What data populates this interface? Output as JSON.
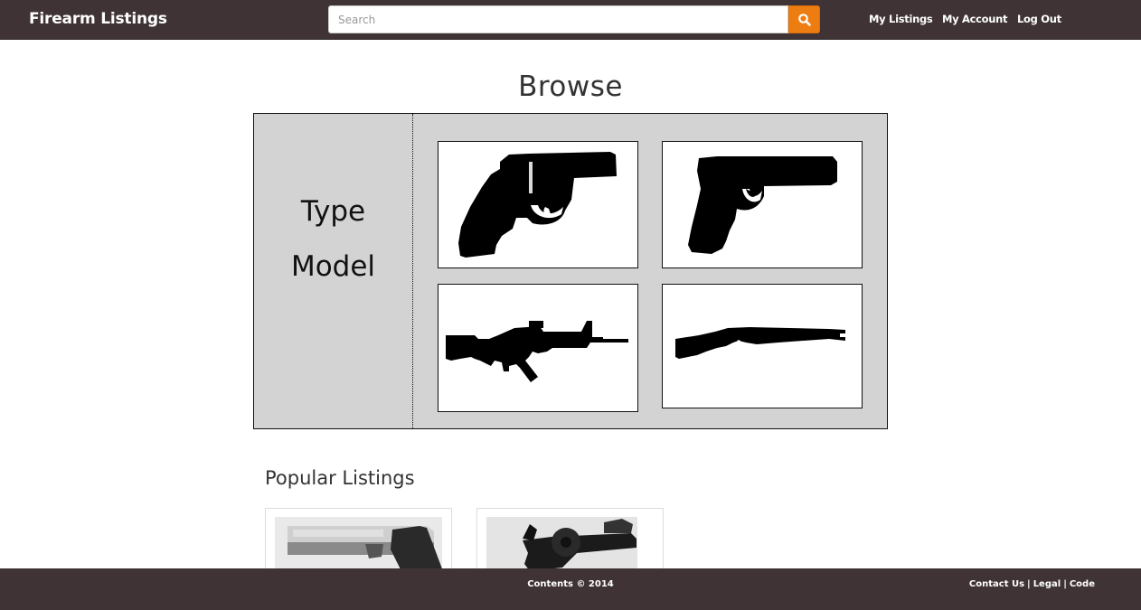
{
  "header": {
    "brand": "Firearm Listings",
    "search": {
      "placeholder": "Search",
      "value": "",
      "button_icon": "search-icon"
    },
    "nav": [
      {
        "label": "My Listings"
      },
      {
        "label": "My Account"
      },
      {
        "label": "Log Out"
      }
    ]
  },
  "browse": {
    "title": "Browse",
    "filters": [
      {
        "label": "Type"
      },
      {
        "label": "Model"
      }
    ],
    "tiles": [
      {
        "icon": "revolver-icon"
      },
      {
        "icon": "pistol-icon"
      },
      {
        "icon": "rifle-icon"
      },
      {
        "icon": "shotgun-icon"
      }
    ]
  },
  "popular": {
    "title": "Popular Listings",
    "items": [
      {
        "image": "silver-pistol-photo"
      },
      {
        "image": "black-revolver-photo"
      }
    ]
  },
  "footer": {
    "copyright": "Contents © 2014",
    "links": [
      {
        "label": "Contact Us"
      },
      {
        "label": "Legal"
      },
      {
        "label": "Code"
      }
    ],
    "separator": "|"
  },
  "colors": {
    "navbar": "#3f3335",
    "search_button": "#ee7d11",
    "panel": "#d3d3d3"
  }
}
